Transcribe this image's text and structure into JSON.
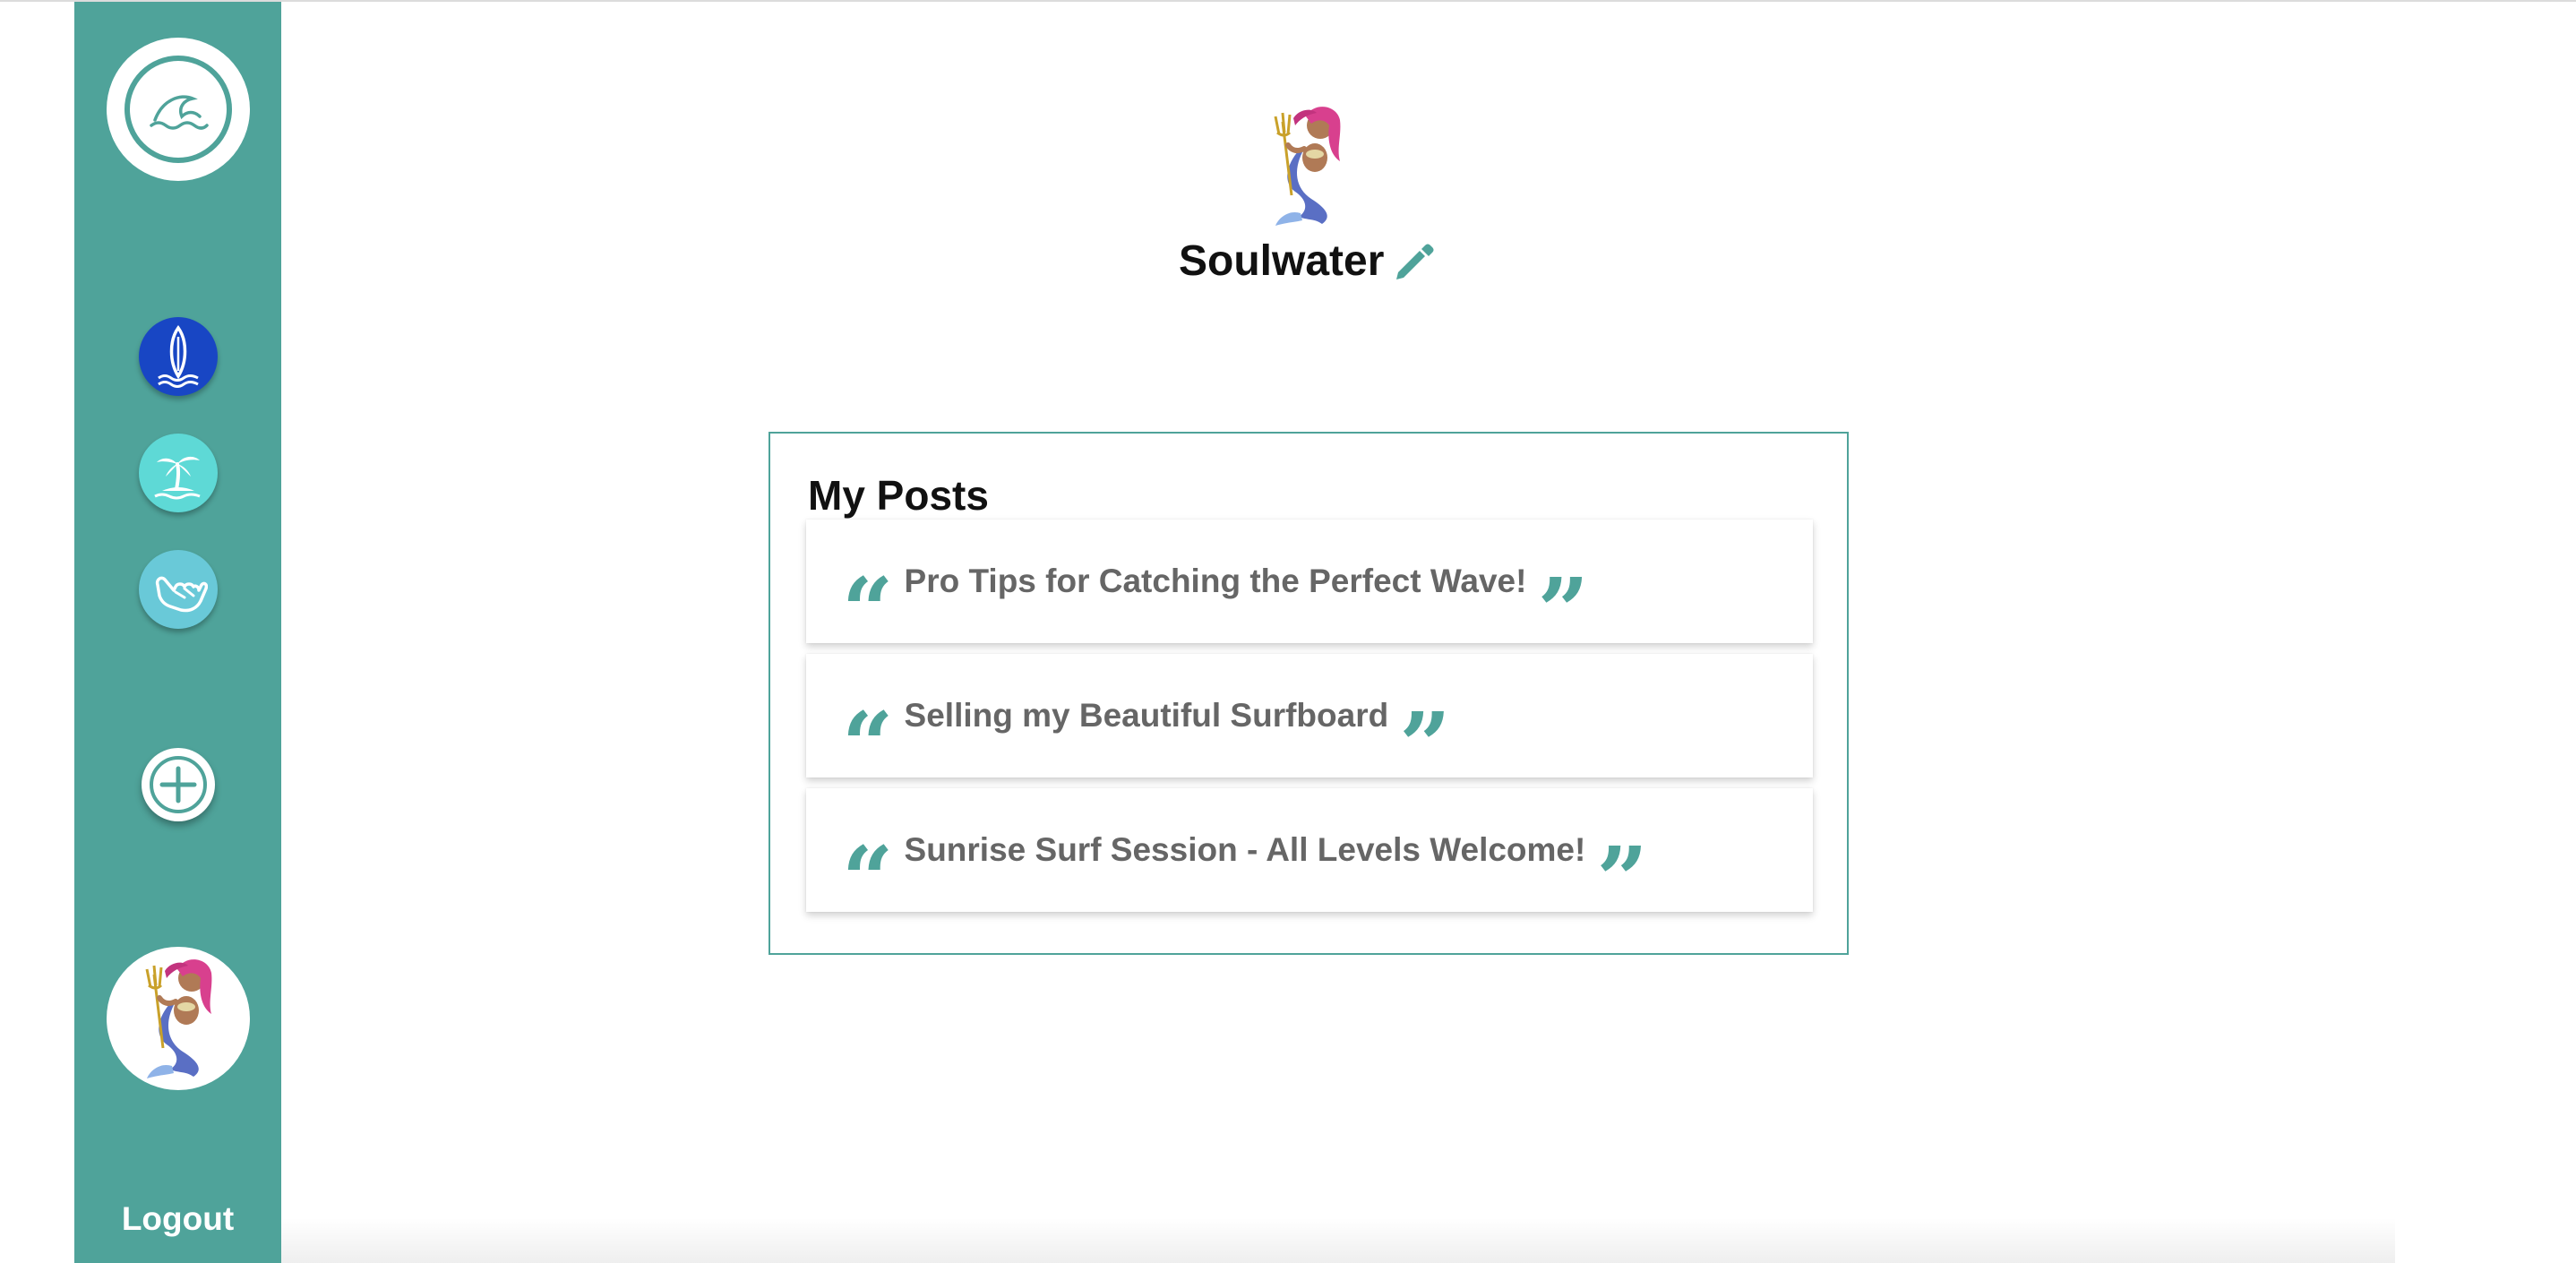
{
  "sidebar": {
    "logo_icon": "wave-icon",
    "nav": [
      {
        "icon": "surfboard-icon",
        "color": "#1846c4"
      },
      {
        "icon": "palm-island-icon",
        "color": "#5ed9d6"
      },
      {
        "icon": "shaka-hand-icon",
        "color": "#69c9d8"
      }
    ],
    "add_icon": "plus-icon",
    "avatar_icon": "mermaid-emoji",
    "logout_label": "Logout",
    "background": "#4fa39a"
  },
  "profile": {
    "avatar_icon": "mermaid-emoji",
    "username": "Soulwater",
    "edit_icon": "pencil-icon"
  },
  "posts": {
    "title": "My Posts",
    "items": [
      {
        "title": "Pro Tips for Catching the Perfect Wave!"
      },
      {
        "title": "Selling my Beautiful Surfboard"
      },
      {
        "title": "Sunrise Surf Session - All Levels Welcome!"
      }
    ]
  },
  "colors": {
    "accent": "#4fa39a",
    "post_text": "#666666"
  }
}
